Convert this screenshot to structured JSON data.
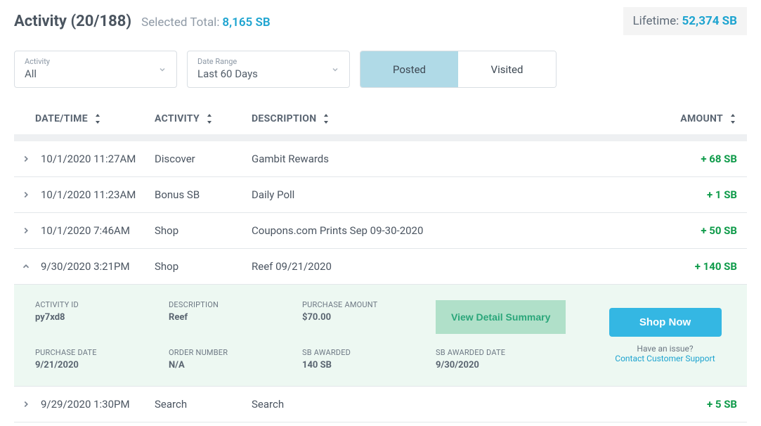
{
  "header": {
    "title": "Activity (20/188)",
    "selected_label": "Selected Total:",
    "selected_value": "8,165 SB",
    "lifetime_label": "Lifetime:",
    "lifetime_value": "52,374 SB"
  },
  "filters": {
    "activity": {
      "label": "Activity",
      "value": "All"
    },
    "date_range": {
      "label": "Date Range",
      "value": "Last 60 Days"
    }
  },
  "tabs": {
    "posted": "Posted",
    "visited": "Visited"
  },
  "columns": {
    "datetime": "DATE/TIME",
    "activity": "ACTIVITY",
    "description": "DESCRIPTION",
    "amount": "AMOUNT"
  },
  "rows": [
    {
      "datetime": "10/1/2020 11:27AM",
      "activity": "Discover",
      "description": "Gambit Rewards",
      "amount": "+ 68 SB"
    },
    {
      "datetime": "10/1/2020 11:23AM",
      "activity": "Bonus SB",
      "description": "Daily Poll",
      "amount": "+ 1 SB"
    },
    {
      "datetime": "10/1/2020 7:46AM",
      "activity": "Shop",
      "description": "Coupons.com Prints Sep 09-30-2020",
      "amount": "+ 50 SB"
    },
    {
      "datetime": "9/30/2020 3:21PM",
      "activity": "Shop",
      "description": "Reef 09/21/2020",
      "amount": "+ 140 SB"
    },
    {
      "datetime": "9/29/2020 1:30PM",
      "activity": "Search",
      "description": "Search",
      "amount": "+ 5 SB"
    }
  ],
  "detail": {
    "activity_id": {
      "label": "ACTIVITY ID",
      "value": "py7xd8"
    },
    "description": {
      "label": "DESCRIPTION",
      "value": "Reef"
    },
    "purchase_amount": {
      "label": "PURCHASE AMOUNT",
      "value": "$70.00"
    },
    "purchase_date": {
      "label": "PURCHASE DATE",
      "value": "9/21/2020"
    },
    "order_number": {
      "label": "ORDER NUMBER",
      "value": "N/A"
    },
    "sb_awarded": {
      "label": "SB AWARDED",
      "value": "140 SB"
    },
    "sb_awarded_date": {
      "label": "SB AWARDED DATE",
      "value": "9/30/2020"
    },
    "view_summary": "View Detail Summary",
    "shop_now": "Shop Now",
    "issue_label": "Have an issue?",
    "issue_link": "Contact Customer Support"
  }
}
